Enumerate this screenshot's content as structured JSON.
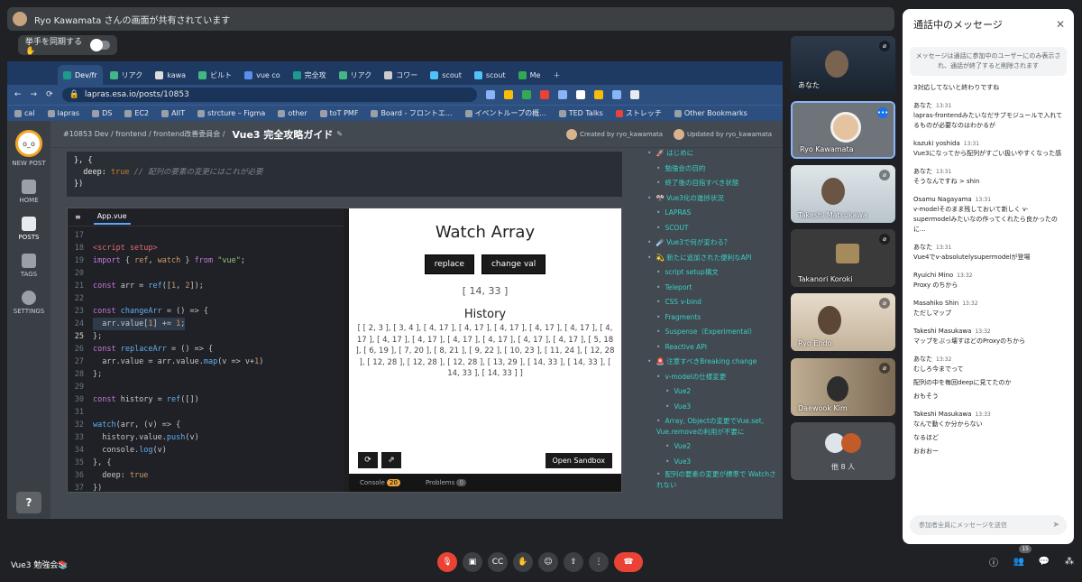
{
  "presenter": {
    "text": "Ryo Kawamata さんの画面が共有されています"
  },
  "raise_hand": {
    "label": "挙手を同期する ✋"
  },
  "browser": {
    "tabs": [
      "Dev/fr",
      "リアク",
      "kawa",
      "ビルト",
      "vue co",
      "完全攻",
      "リアク",
      "コワー",
      "scout",
      "scout",
      "Me"
    ],
    "url": "lapras.esa.io/posts/10853",
    "bookmarks": [
      "cal",
      "lapras",
      "DS",
      "EC2",
      "AIIT",
      "strcture – Figma",
      "other",
      "toT PMF",
      "Board - フロントエ...",
      "イベントループの概...",
      "TED Talks",
      "ストレッチ",
      "Other Bookmarks"
    ]
  },
  "esa": {
    "sidebar": [
      "NEW POST",
      "HOME",
      "POSTS",
      "TAGS",
      "SETTINGS"
    ],
    "help": "?",
    "breadcrumb": "#10853 Dev / frontend / frontend改善委員会 /",
    "title": "Vue3 完全攻略ガイド",
    "created_by": "Created by ryo_kawamata",
    "updated_by": "Updated by ryo_kawamata",
    "code_top": {
      "l1": "}, {",
      "l2_key": "deep",
      "l2_val": "true",
      "l2_comment": "// 配列の要素の変更にはこれが必要",
      "l3": "})"
    }
  },
  "editor": {
    "file": "App.vue",
    "line_numbers": [
      "17",
      "18",
      "19",
      "20",
      "21",
      "22",
      "23",
      "24",
      "25",
      "26",
      "27",
      "28",
      "29",
      "30",
      "31",
      "32",
      "33",
      "34",
      "35",
      "36",
      "37"
    ]
  },
  "preview": {
    "title": "Watch Array",
    "btn_replace": "replace",
    "btn_change": "change val",
    "array": "[ 14, 33 ]",
    "history_title": "History",
    "history": "[ [ 2, 3 ], [ 3, 4 ], [ 4, 17 ], [ 4, 17 ], [ 4, 17 ], [ 4, 17 ], [ 4, 17 ], [ 4, 17 ], [ 4, 17 ], [ 4, 17 ], [ 4, 17 ], [ 4, 17 ], [ 4, 17 ], [ 4, 17 ], [ 5, 18 ], [ 6, 19 ], [ 7, 20 ], [ 8, 21 ], [ 9, 22 ], [ 10, 23 ], [ 11, 24 ], [ 12, 28 ], [ 12, 28 ], [ 12, 28 ], [ 12, 28 ], [ 13, 29 ], [ 14, 33 ], [ 14, 33 ], [ 14, 33 ], [ 14, 33 ] ]",
    "open_sandbox": "Open Sandbox",
    "console": "Console",
    "console_count": "20",
    "problems": "Problems",
    "problems_count": "0"
  },
  "toc": [
    {
      "level": 1,
      "text": "🚀 はじめに"
    },
    {
      "level": 2,
      "text": "勉強会の目的"
    },
    {
      "level": 2,
      "text": "終了後の目指すべき状態"
    },
    {
      "level": 1,
      "text": "🎌 Vue3化の進捗状況"
    },
    {
      "level": 2,
      "text": "LAPRAS"
    },
    {
      "level": 2,
      "text": "SCOUT"
    },
    {
      "level": 1,
      "text": "☄️ Vue3で何が変わる？"
    },
    {
      "level": 1,
      "text": "💫 新たに追加された便利なAPI"
    },
    {
      "level": 2,
      "text": "script setup構文"
    },
    {
      "level": 2,
      "text": "Teleport"
    },
    {
      "level": 2,
      "text": "CSS v-bind"
    },
    {
      "level": 2,
      "text": "Fragments"
    },
    {
      "level": 2,
      "text": "Suspense（Experimental）"
    },
    {
      "level": 2,
      "text": "Reactive API"
    },
    {
      "level": 1,
      "text": "🚨 注意すべきBreaking change"
    },
    {
      "level": 2,
      "text": "v-modelの仕様変更"
    },
    {
      "level": 3,
      "text": "Vue2"
    },
    {
      "level": 3,
      "text": "Vue3"
    },
    {
      "level": 2,
      "text": "Array, Objectの変更でVue.set, Vue.removeの利用が不要に"
    },
    {
      "level": 3,
      "text": "Vue2"
    },
    {
      "level": 3,
      "text": "Vue3"
    },
    {
      "level": 2,
      "text": "配列の要素の変更が標準で Watchされない"
    }
  ],
  "participants": [
    {
      "name": "あなた"
    },
    {
      "name": "Ryo Kawamata"
    },
    {
      "name": "Takeshi Matsukawa"
    },
    {
      "name": "Takanori Koroki"
    },
    {
      "name": "Ryo Endo"
    },
    {
      "name": "Daewook Kim"
    },
    {
      "name": "他 8 人"
    }
  ],
  "chat": {
    "title": "通話中のメッセージ",
    "notice": "メッセージは通話に参加中のユーザーにのみ表示され、通話が終了すると削除されます",
    "messages": [
      {
        "author": "",
        "time": "",
        "lines": [
          "3対応してないと終わりですね"
        ]
      },
      {
        "author": "あなた",
        "time": "13:31",
        "lines": [
          "lapras-frontendみたいなだサブモジュールで入れてるものが必要なのはわかるが"
        ]
      },
      {
        "author": "kazuki yoshida",
        "time": "13:31",
        "lines": [
          "Vue3になってから配列がすごい扱いやすくなった感"
        ]
      },
      {
        "author": "あなた",
        "time": "13:31",
        "lines": [
          "そうなんですね > shin"
        ]
      },
      {
        "author": "Osamu Nagayama",
        "time": "13:31",
        "lines": [
          "v-modelそのまま残しておいて新しく v-supermodelみたいなの作ってくれたら良かったのに..."
        ]
      },
      {
        "author": "あなた",
        "time": "13:31",
        "lines": [
          "Vue4でv-absolutelysupermodelが登場"
        ]
      },
      {
        "author": "Ryuichi Mino",
        "time": "13:32",
        "lines": [
          "Proxy のちから"
        ]
      },
      {
        "author": "Masahiko Shin",
        "time": "13:32",
        "lines": [
          "ただしマップ"
        ]
      },
      {
        "author": "Takeshi Masukawa",
        "time": "13:32",
        "lines": [
          "マップをぶっ壊すほどのProxyのちから"
        ]
      },
      {
        "author": "あなた",
        "time": "13:32",
        "lines": [
          "むしろ今までって",
          "配列の中を毎回deepに見てたのか",
          "おもそう"
        ]
      },
      {
        "author": "Takeshi Masukawa",
        "time": "13:33",
        "lines": [
          "なんで動くか分からない",
          "なるほど",
          "おおおー"
        ]
      }
    ],
    "input_placeholder": "参加者全員にメッセージを送信"
  },
  "meeting": {
    "name": "Vue3 勉強会📚",
    "participant_count": "15"
  }
}
